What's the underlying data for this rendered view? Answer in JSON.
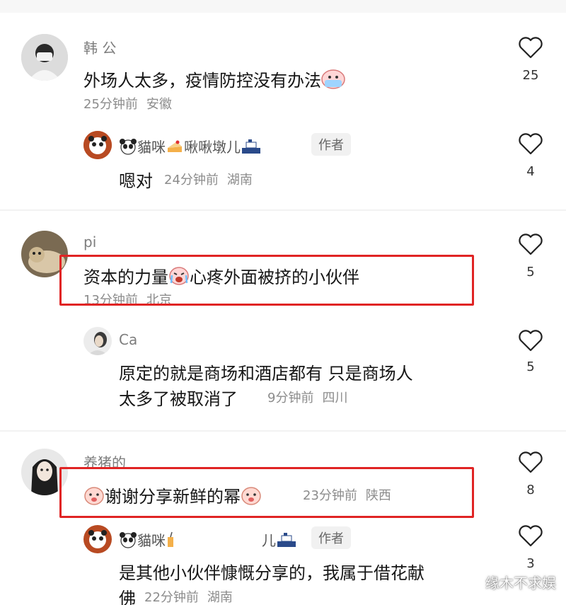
{
  "comments": [
    {
      "username": "韩 公",
      "text": "外场人太多，疫情防控没有办法",
      "time": "25分钟前",
      "location": "安徽",
      "likes": "25",
      "reply": {
        "username_a": "貓咪",
        "username_b": "啾啾墩儿",
        "author_badge": "作者",
        "text": "嗯对",
        "time": "24分钟前",
        "location": "湖南",
        "likes": "4"
      }
    },
    {
      "username": "pi",
      "text": "资本的力量",
      "text_after_emoji": "心疼外面被挤的小伙伴",
      "time": "13分钟前",
      "location": "北京",
      "likes": "5",
      "reply": {
        "username": "Ca",
        "text_line1": "原定的就是商场和酒店都有 只是商场人",
        "text_line2": "太多了被取消了",
        "time": "9分钟前",
        "location": "四川",
        "likes": "5"
      }
    },
    {
      "username": "养猪的",
      "text": "谢谢分享新鲜的幂",
      "time": "23分钟前",
      "location": "陕西",
      "likes": "8",
      "reply": {
        "username_a": "貓咪",
        "username_b": "儿",
        "author_badge": "作者",
        "text_line1": "是其他小伙伴慷慨分享的，我属于借花献",
        "text_line2": "佛",
        "time": "22分钟前",
        "location": "湖南",
        "likes": "3"
      }
    }
  ],
  "watermark": "缘木不求娱",
  "colors": {
    "highlight_box": "#e02424",
    "meta_text": "#8c8c8c"
  }
}
